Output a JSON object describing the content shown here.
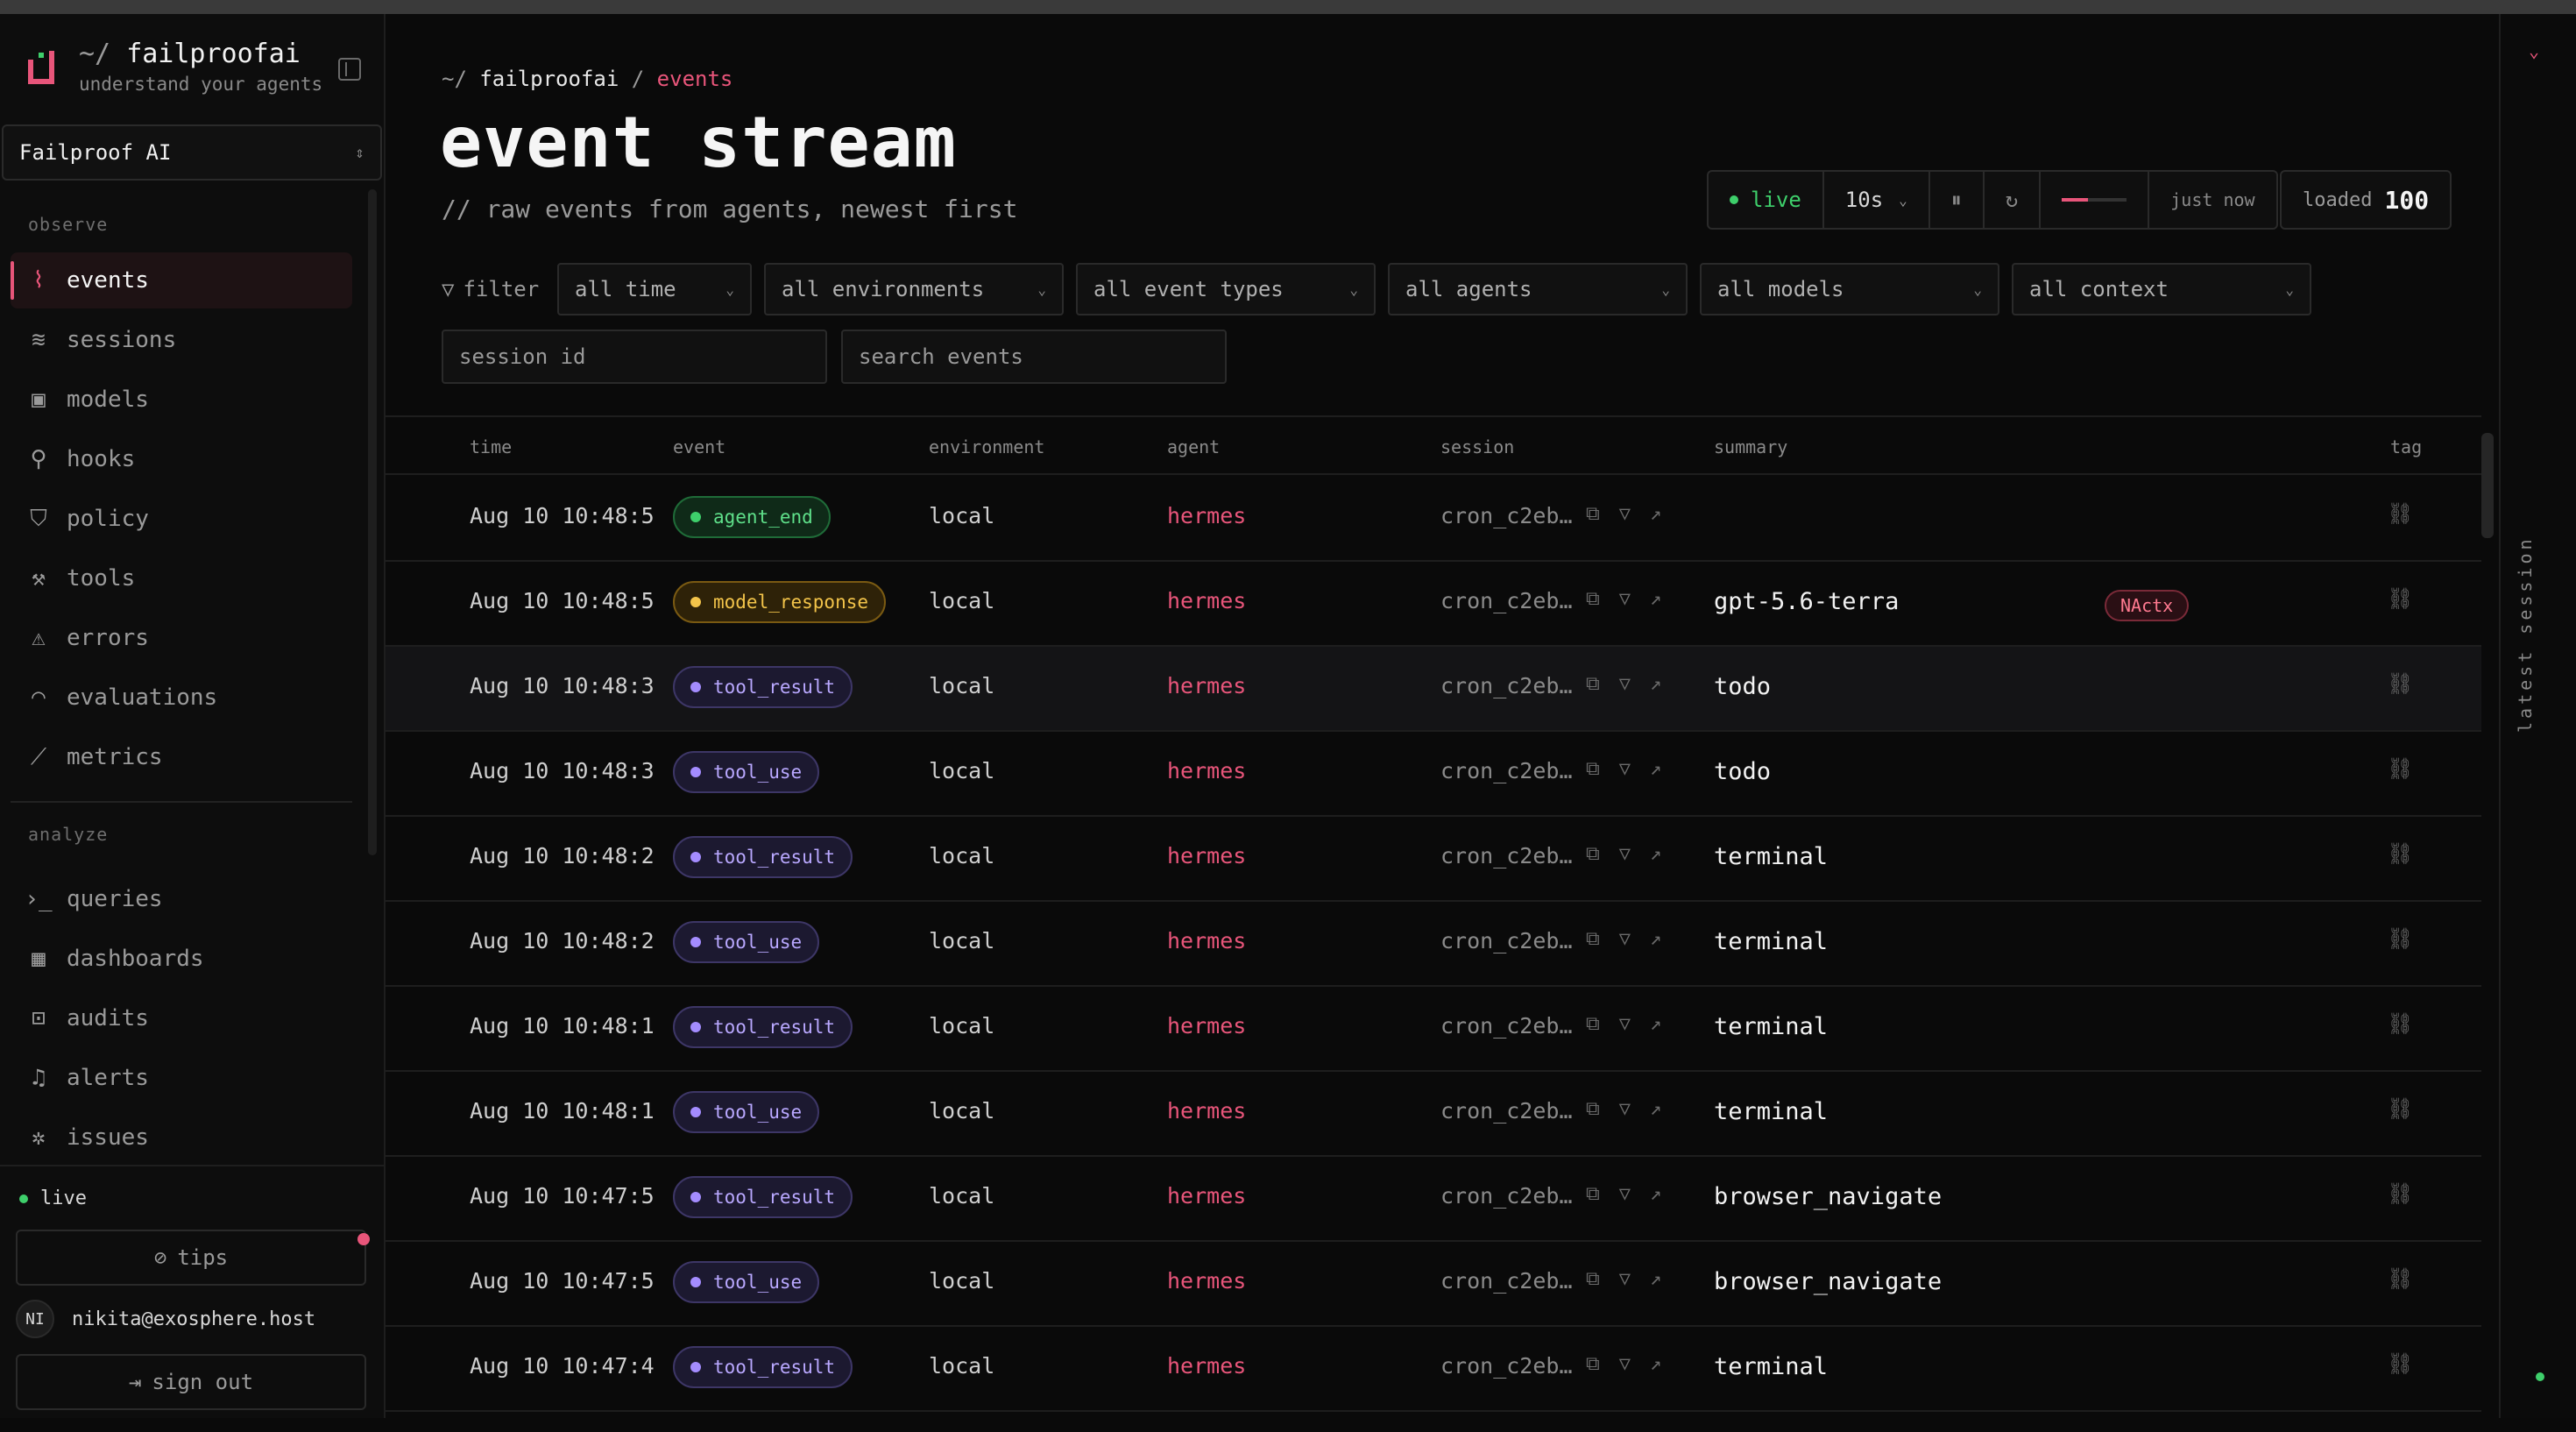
{
  "brand": {
    "tilde": "~/",
    "name": "failproofai",
    "tagline": "understand your agents"
  },
  "workspace": {
    "name": "Failproof AI"
  },
  "sidebar": {
    "observe_label": "observe",
    "analyze_label": "analyze",
    "observe": [
      {
        "label": "events",
        "icon": "activity-icon",
        "active": true
      },
      {
        "label": "sessions",
        "icon": "layers-icon"
      },
      {
        "label": "models",
        "icon": "cpu-icon"
      },
      {
        "label": "hooks",
        "icon": "webhook-icon"
      },
      {
        "label": "policy",
        "icon": "shield-icon"
      },
      {
        "label": "tools",
        "icon": "wrench-icon"
      },
      {
        "label": "errors",
        "icon": "warning-icon"
      },
      {
        "label": "evaluations",
        "icon": "gauge-icon"
      },
      {
        "label": "metrics",
        "icon": "ruler-icon"
      }
    ],
    "analyze": [
      {
        "label": "queries",
        "icon": "terminal-icon"
      },
      {
        "label": "dashboards",
        "icon": "grid-icon"
      },
      {
        "label": "audits",
        "icon": "scan-icon"
      },
      {
        "label": "alerts",
        "icon": "bell-icon"
      },
      {
        "label": "issues",
        "icon": "bug-icon"
      }
    ],
    "live": "live",
    "tips": "tips",
    "user_initials": "NI",
    "user_email": "nikita@exosphere.host",
    "sign_out": "sign out"
  },
  "header": {
    "crumb_home": "~/",
    "crumb_root": "failproofai",
    "crumb_sep": "/",
    "crumb_current": "events",
    "title": "event stream",
    "subtitle": "// raw events from agents, newest first"
  },
  "controls": {
    "live": "live",
    "interval": "10s",
    "updated": "just now",
    "loaded_label": "loaded",
    "loaded_value": "100"
  },
  "filters": {
    "label": "filter",
    "selects": [
      "all time",
      "all environments",
      "all event types",
      "all agents",
      "all models",
      "all context"
    ],
    "session_placeholder": "session id",
    "search_placeholder": "search events"
  },
  "table": {
    "columns": [
      "time",
      "event",
      "environment",
      "agent",
      "session",
      "summary",
      "tag"
    ],
    "rows": [
      {
        "time": "Aug 10 10:48:5",
        "event": "agent_end",
        "color": "green",
        "env": "local",
        "agent": "hermes",
        "session": "cron_c2eb…",
        "summary": ""
      },
      {
        "time": "Aug 10 10:48:5",
        "event": "model_response",
        "color": "yellow",
        "env": "local",
        "agent": "hermes",
        "session": "cron_c2eb…",
        "summary": "gpt-5.6-terra",
        "badge": "NActx"
      },
      {
        "time": "Aug 10 10:48:3",
        "event": "tool_result",
        "color": "purple",
        "env": "local",
        "agent": "hermes",
        "session": "cron_c2eb…",
        "summary": "todo"
      },
      {
        "time": "Aug 10 10:48:3",
        "event": "tool_use",
        "color": "purple",
        "env": "local",
        "agent": "hermes",
        "session": "cron_c2eb…",
        "summary": "todo"
      },
      {
        "time": "Aug 10 10:48:2",
        "event": "tool_result",
        "color": "purple",
        "env": "local",
        "agent": "hermes",
        "session": "cron_c2eb…",
        "summary": "terminal"
      },
      {
        "time": "Aug 10 10:48:2",
        "event": "tool_use",
        "color": "purple",
        "env": "local",
        "agent": "hermes",
        "session": "cron_c2eb…",
        "summary": "terminal"
      },
      {
        "time": "Aug 10 10:48:1",
        "event": "tool_result",
        "color": "purple",
        "env": "local",
        "agent": "hermes",
        "session": "cron_c2eb…",
        "summary": "terminal"
      },
      {
        "time": "Aug 10 10:48:1",
        "event": "tool_use",
        "color": "purple",
        "env": "local",
        "agent": "hermes",
        "session": "cron_c2eb…",
        "summary": "terminal"
      },
      {
        "time": "Aug 10 10:47:5",
        "event": "tool_result",
        "color": "purple",
        "env": "local",
        "agent": "hermes",
        "session": "cron_c2eb…",
        "summary": "browser_navigate"
      },
      {
        "time": "Aug 10 10:47:5",
        "event": "tool_use",
        "color": "purple",
        "env": "local",
        "agent": "hermes",
        "session": "cron_c2eb…",
        "summary": "browser_navigate"
      },
      {
        "time": "Aug 10 10:47:4",
        "event": "tool_result",
        "color": "purple",
        "env": "local",
        "agent": "hermes",
        "session": "cron_c2eb…",
        "summary": "terminal"
      }
    ]
  },
  "rail": {
    "label": "latest session"
  },
  "colors": {
    "accent": "#e8557a",
    "live": "#3ecf6b",
    "background": "#0a0a0a"
  }
}
